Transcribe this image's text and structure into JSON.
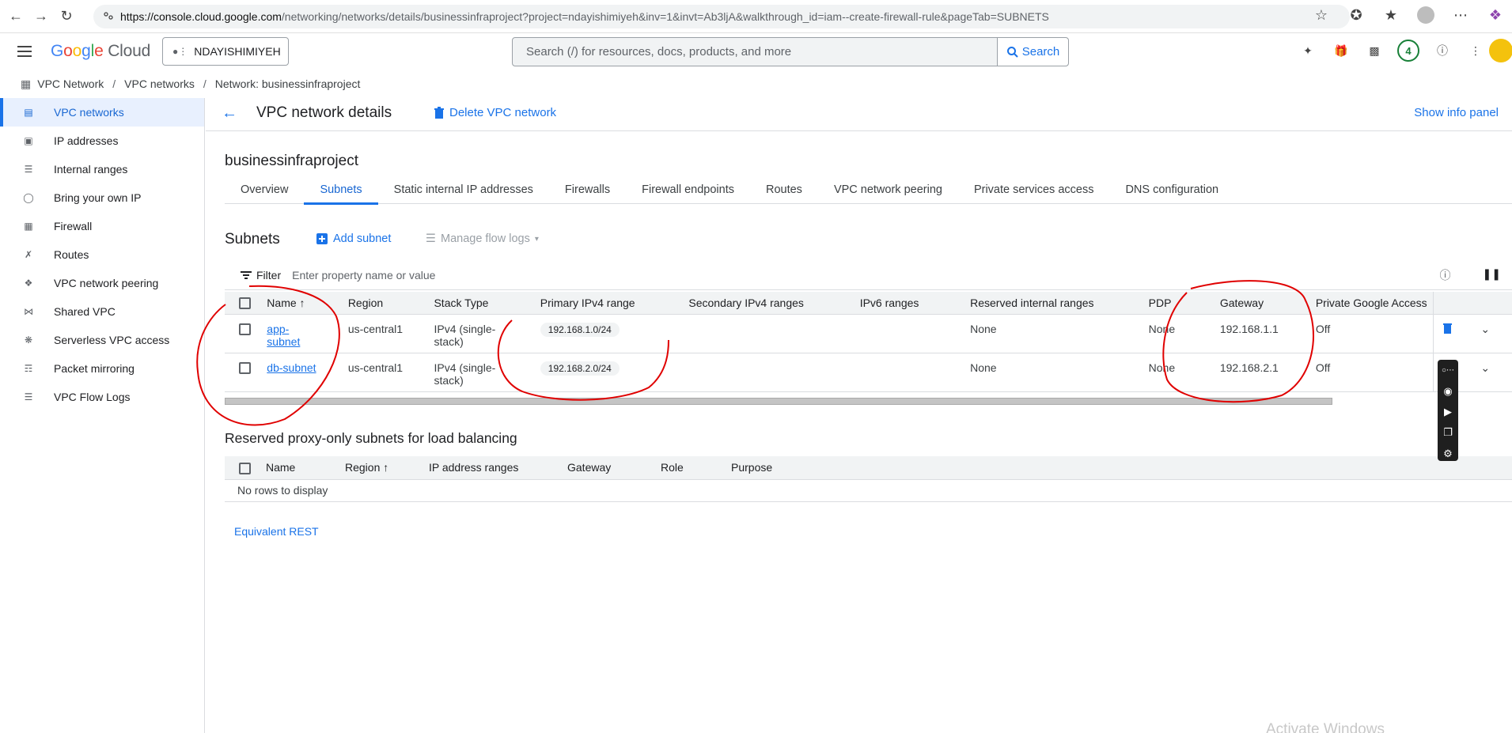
{
  "browser": {
    "url_host": "https://console.cloud.google.com",
    "url_rest": "/networking/networks/details/businessinfraproject?project=ndayishimiyeh&inv=1&invt=Ab3ljA&walkthrough_id=iam--create-firewall-rule&pageTab=SUBNETS"
  },
  "header": {
    "logo_google": "Google",
    "logo_cloud": "Cloud",
    "project": "NDAYISHIMIYEH",
    "search_placeholder": "Search (/) for resources, docs, products, and more",
    "search_button": "Search",
    "notifications_count": "4"
  },
  "breadcrumb": [
    "VPC Network",
    "VPC networks",
    "Network: businessinfraproject"
  ],
  "sidebar": {
    "items": [
      {
        "label": "VPC networks",
        "icon": "vpc-icon",
        "active": true
      },
      {
        "label": "IP addresses",
        "icon": "ip-address-icon"
      },
      {
        "label": "Internal ranges",
        "icon": "internal-ranges-icon"
      },
      {
        "label": "Bring your own IP",
        "icon": "globe-icon"
      },
      {
        "label": "Firewall",
        "icon": "firewall-icon"
      },
      {
        "label": "Routes",
        "icon": "routes-icon"
      },
      {
        "label": "VPC network peering",
        "icon": "peering-icon"
      },
      {
        "label": "Shared VPC",
        "icon": "shared-vpc-icon"
      },
      {
        "label": "Serverless VPC access",
        "icon": "serverless-icon"
      },
      {
        "label": "Packet mirroring",
        "icon": "packet-mirroring-icon"
      },
      {
        "label": "VPC Flow Logs",
        "icon": "flow-logs-icon"
      }
    ]
  },
  "main": {
    "title": "VPC network details",
    "delete_label": "Delete VPC network",
    "info_panel_label": "Show info panel",
    "network_name": "businessinfraproject",
    "tabs": [
      "Overview",
      "Subnets",
      "Static internal IP addresses",
      "Firewalls",
      "Firewall endpoints",
      "Routes",
      "VPC network peering",
      "Private services access",
      "DNS configuration"
    ],
    "active_tab": "Subnets"
  },
  "subnets": {
    "title": "Subnets",
    "add_label": "Add subnet",
    "manage_flow_logs_label": "Manage flow logs",
    "filter_label": "Filter",
    "filter_placeholder": "Enter property name or value",
    "columns": [
      "Name",
      "Region",
      "Stack Type",
      "Primary IPv4 range",
      "Secondary IPv4 ranges",
      "IPv6 ranges",
      "Reserved internal ranges",
      "PDP",
      "Gateway",
      "Private Google Access"
    ],
    "rows": [
      {
        "name_line1": "app-",
        "name_line2": "subnet",
        "region": "us-central1",
        "stack1": "IPv4 (single-",
        "stack2": "stack)",
        "primary": "192.168.1.0/24",
        "secondary": "",
        "ipv6": "",
        "reserved": "None",
        "pdp": "None",
        "gateway": "192.168.1.1",
        "pga": "Off"
      },
      {
        "name_line1": "db-subnet",
        "name_line2": "",
        "region": "us-central1",
        "stack1": "IPv4 (single-",
        "stack2": "stack)",
        "primary": "192.168.2.0/24",
        "secondary": "",
        "ipv6": "",
        "reserved": "None",
        "pdp": "None",
        "gateway": "192.168.2.1",
        "pga": "Off"
      }
    ]
  },
  "proxy": {
    "title": "Reserved proxy-only subnets for load balancing",
    "columns": [
      "Name",
      "Region",
      "IP address ranges",
      "Gateway",
      "Role",
      "Purpose"
    ],
    "empty": "No rows to display"
  },
  "equivalent_rest": "Equivalent REST",
  "watermark": "Activate Windows",
  "colors": {
    "accent": "#1a73e8",
    "annotation": "#e00000"
  }
}
